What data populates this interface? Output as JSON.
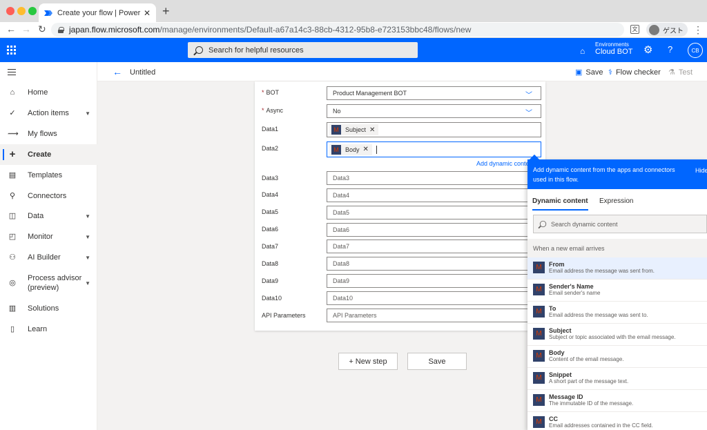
{
  "browser": {
    "tab_title": "Create your flow | Power Automate",
    "new_tab": "+",
    "url_host": "japan.flow.microsoft.com",
    "url_path": "/manage/environments/Default-a67a14c3-88cb-4312-95b8-e723153bbc48/flows/new",
    "profile_label": "ゲスト",
    "translate_icon": "文"
  },
  "header": {
    "search_placeholder": "Search for helpful resources",
    "env_label": "Environments",
    "env_name": "Cloud BOT",
    "avatar_initials": "CB"
  },
  "sidebar": {
    "items": [
      {
        "label": "Home",
        "icon": "⌂"
      },
      {
        "label": "Action items",
        "icon": "✓"
      },
      {
        "label": "My flows",
        "icon": "⟿"
      },
      {
        "label": "Create",
        "icon": "+"
      },
      {
        "label": "Templates",
        "icon": "▤"
      },
      {
        "label": "Connectors",
        "icon": "⚲"
      },
      {
        "label": "Data",
        "icon": "◫"
      },
      {
        "label": "Monitor",
        "icon": "◰"
      },
      {
        "label": "AI Builder",
        "icon": "⚇"
      },
      {
        "label": "Process advisor",
        "label2": "(preview)",
        "icon": "◎"
      },
      {
        "label": "Solutions",
        "icon": "▥"
      },
      {
        "label": "Learn",
        "icon": "▯"
      }
    ]
  },
  "cmdbar": {
    "title": "Untitled",
    "save": "Save",
    "checker": "Flow checker",
    "test": "Test"
  },
  "form": {
    "bot_label": "BOT",
    "bot_value": "Product Management BOT",
    "async_label": "Async",
    "async_value": "No",
    "data1_label": "Data1",
    "data1_token": "Subject",
    "data2_label": "Data2",
    "data2_token": "Body",
    "add_dynamic": "Add dynamic conte",
    "data3_label": "Data3",
    "data3_ph": "Data3",
    "data4_label": "Data4",
    "data4_ph": "Data4",
    "data5_label": "Data5",
    "data5_ph": "Data5",
    "data6_label": "Data6",
    "data6_ph": "Data6",
    "data7_label": "Data7",
    "data7_ph": "Data7",
    "data8_label": "Data8",
    "data8_ph": "Data8",
    "data9_label": "Data9",
    "data9_ph": "Data9",
    "data10_label": "Data10",
    "data10_ph": "Data10",
    "api_label": "API Parameters",
    "api_ph": "API Parameters"
  },
  "buttons": {
    "new_step": "+ New step",
    "save": "Save"
  },
  "flyout": {
    "header": "Add dynamic content from the apps and connectors used in this flow.",
    "hide": "Hide",
    "tab_dynamic": "Dynamic content",
    "tab_expression": "Expression",
    "search_placeholder": "Search dynamic content",
    "section": "When a new email arrives",
    "items": [
      {
        "name": "From",
        "desc": "Email address the message was sent from."
      },
      {
        "name": "Sender's Name",
        "desc": "Email sender's name"
      },
      {
        "name": "To",
        "desc": "Email address the message was sent to."
      },
      {
        "name": "Subject",
        "desc": "Subject or topic associated with the email message."
      },
      {
        "name": "Body",
        "desc": "Content of the email message."
      },
      {
        "name": "Snippet",
        "desc": "A short part of the message text."
      },
      {
        "name": "Message ID",
        "desc": "The immutable ID of the message."
      },
      {
        "name": "CC",
        "desc": "Email addresses contained in the CC field."
      }
    ]
  },
  "colors": {
    "brand": "#0066ff",
    "gmail_icon_bg": "#31426a"
  }
}
